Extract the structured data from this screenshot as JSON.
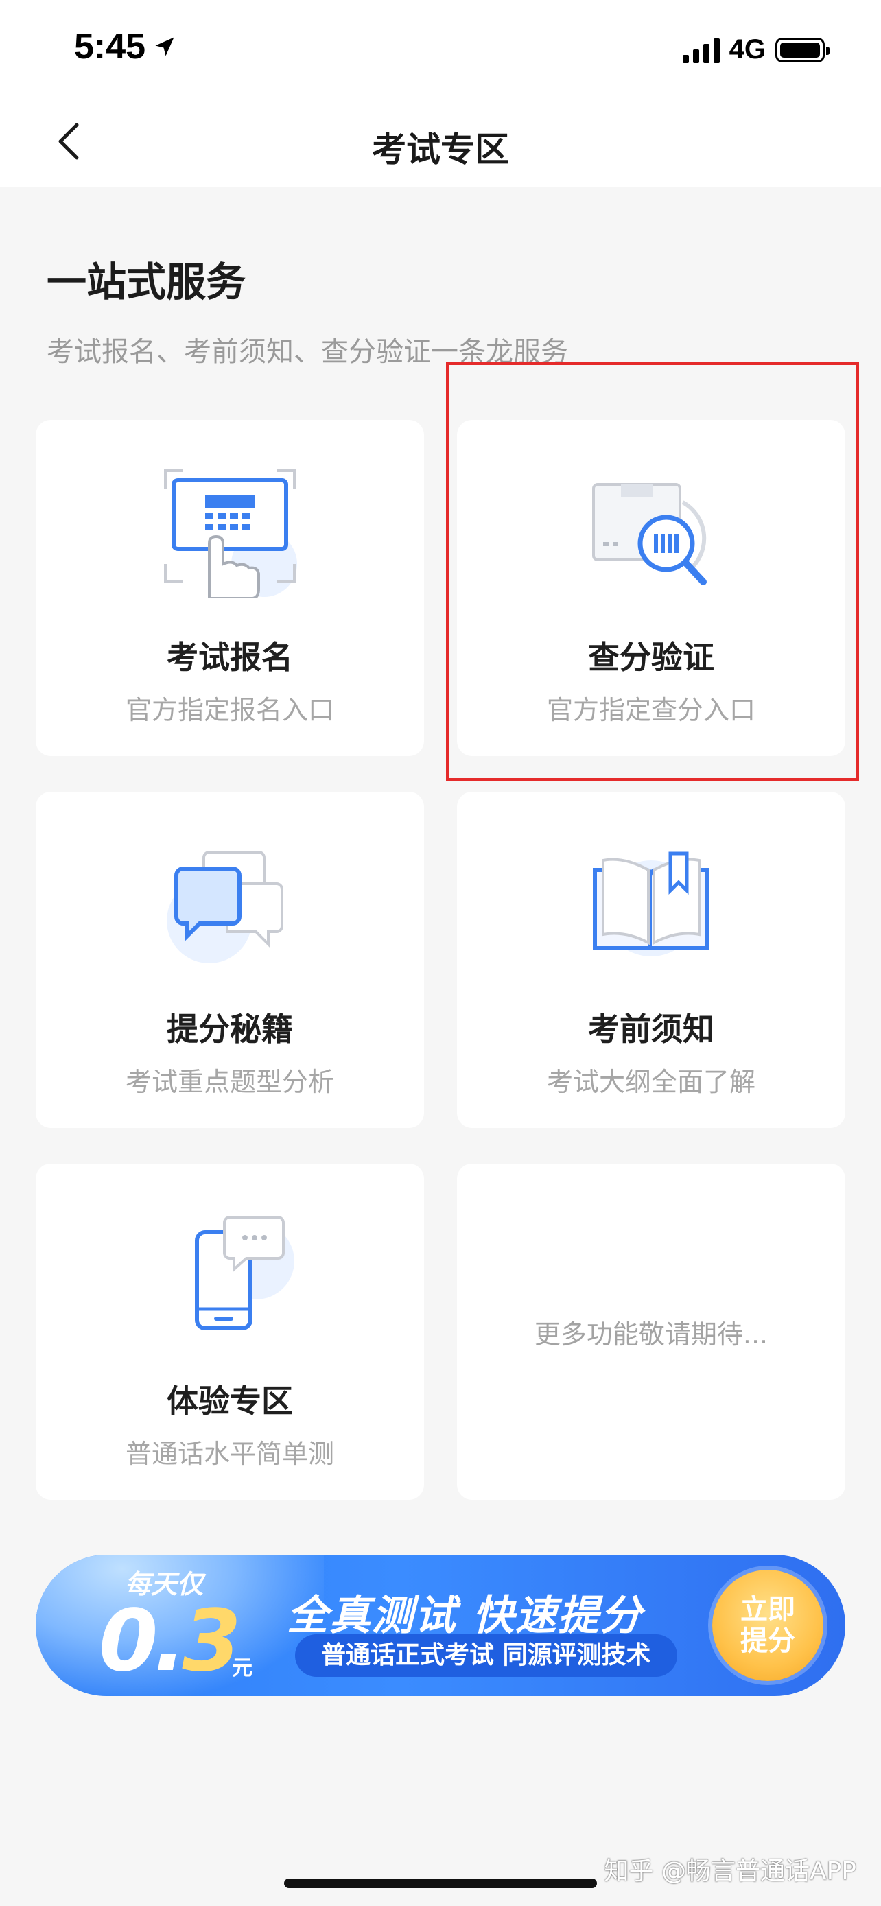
{
  "status_bar": {
    "time": "5:45",
    "network": "4G"
  },
  "nav": {
    "title": "考试专区"
  },
  "section": {
    "title": "一站式服务",
    "subtitle": "考试报名、考前须知、查分验证一条龙服务"
  },
  "cards": [
    {
      "title": "考试报名",
      "desc": "官方指定报名入口",
      "icon": "registration-icon"
    },
    {
      "title": "查分验证",
      "desc": "官方指定查分入口",
      "icon": "score-check-icon"
    },
    {
      "title": "提分秘籍",
      "desc": "考试重点题型分析",
      "icon": "chat-bubbles-icon"
    },
    {
      "title": "考前须知",
      "desc": "考试大纲全面了解",
      "icon": "book-icon"
    },
    {
      "title": "体验专区",
      "desc": "普通话水平简单测",
      "icon": "phone-chat-icon"
    },
    {
      "title": "",
      "desc": "更多功能敬请期待..."
    }
  ],
  "banner": {
    "daily": "每天仅",
    "price_a": "0.",
    "price_b": "3",
    "unit": "元",
    "headline": "全真测试 快速提分",
    "pill": "普通话正式考试 同源评测技术",
    "cta_line1": "立即",
    "cta_line2": "提分"
  },
  "watermark": "知乎 @畅言普通话APP",
  "colors": {
    "accent": "#3b8cff",
    "highlight": "#e52b2b",
    "cta": "#ffc24a"
  }
}
